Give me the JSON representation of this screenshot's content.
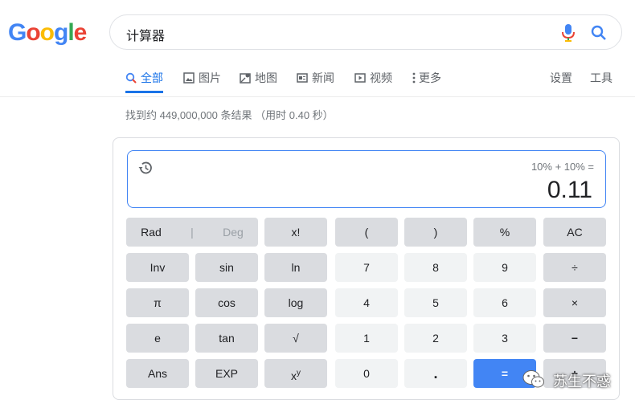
{
  "logo": {
    "letters": [
      {
        "ch": "G",
        "color": "#4285F4"
      },
      {
        "ch": "o",
        "color": "#EA4335"
      },
      {
        "ch": "o",
        "color": "#FBBC05"
      },
      {
        "ch": "g",
        "color": "#4285F4"
      },
      {
        "ch": "l",
        "color": "#34A853"
      },
      {
        "ch": "e",
        "color": "#EA4335"
      }
    ]
  },
  "search": {
    "query": "计算器"
  },
  "tabs": [
    {
      "label": "全部",
      "icon": "search-icon",
      "active": true
    },
    {
      "label": "图片",
      "icon": "image-icon"
    },
    {
      "label": "地图",
      "icon": "map-icon"
    },
    {
      "label": "新闻",
      "icon": "news-icon"
    },
    {
      "label": "视频",
      "icon": "video-icon"
    },
    {
      "label": "更多",
      "icon": "more-vert-icon"
    }
  ],
  "tools": {
    "settings": "设置",
    "tools": "工具"
  },
  "result_stats": "找到约 449,000,000 条结果 （用时 0.40 秒）",
  "calculator": {
    "expression": "10% + 10% =",
    "result": "0.11",
    "keys": {
      "rad": "Rad",
      "deg": "Deg",
      "sep": "|",
      "fact": "x!",
      "lparen": "(",
      "rparen": ")",
      "pct": "%",
      "ac": "AC",
      "inv": "Inv",
      "sin": "sin",
      "ln": "ln",
      "k7": "7",
      "k8": "8",
      "k9": "9",
      "div": "÷",
      "pi": "π",
      "cos": "cos",
      "log": "log",
      "k4": "4",
      "k5": "5",
      "k6": "6",
      "mul": "×",
      "e": "e",
      "tan": "tan",
      "sqrt": "√",
      "k1": "1",
      "k2": "2",
      "k3": "3",
      "minus": "−",
      "ans": "Ans",
      "exp": "EXP",
      "pow_base": "x",
      "pow_exp": "y",
      "k0": "0",
      "dot": ".",
      "eq": "=",
      "plus": "+"
    }
  },
  "watermark": {
    "text": "苏生不惑",
    "icon": "wechat-icon"
  },
  "colors": {
    "accent": "#1a73e8",
    "equals": "#4285f4",
    "op_key": "#dadce0",
    "num_key": "#f1f3f4"
  }
}
